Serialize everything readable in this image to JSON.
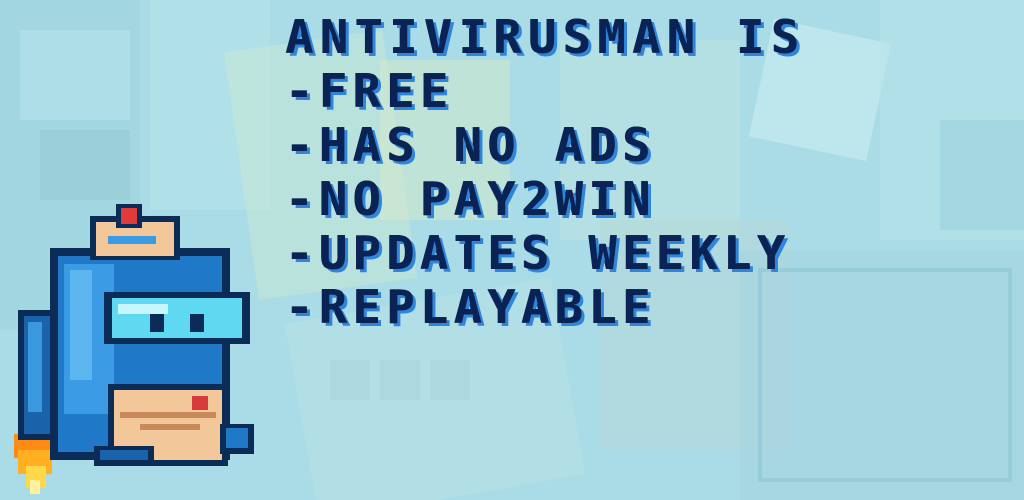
{
  "headline": "Antivirusman is",
  "features": [
    "-Free",
    "-has no ads",
    "-no pay2win",
    "-updates weekly",
    "-replayable"
  ],
  "colors": {
    "background": "#a9dce6",
    "text": "#0b2354",
    "text_shade": "#2f86d8",
    "mascot_body": "#1f78c8",
    "mascot_visor": "#5fd8f2",
    "envelope": "#f2c79a",
    "flame": "#ffb020"
  },
  "icons": [
    "antivirus-mascot-icon",
    "envelope-icon",
    "jet-flame-icon",
    "red-cap-icon"
  ]
}
